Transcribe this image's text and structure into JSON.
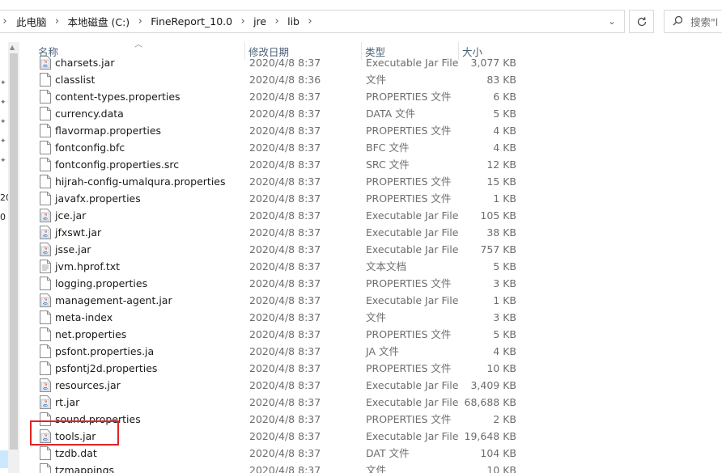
{
  "address_bar": {
    "lead_chevron": "›",
    "separator": "›",
    "breadcrumbs": [
      "此电脑",
      "本地磁盘 (C:)",
      "FineReport_10.0",
      "jre",
      "lib"
    ],
    "dropdown_icon": "chevron-down-icon"
  },
  "refresh": {
    "icon": "refresh-icon"
  },
  "search": {
    "placeholder": "搜索\"l"
  },
  "left_strip": {
    "labels": [
      "20",
      "0"
    ]
  },
  "columns": {
    "name": "名称",
    "date": "修改日期",
    "type": "类型",
    "size": "大小"
  },
  "files": [
    {
      "name": "charsets.jar",
      "date": "2020/4/8 8:37",
      "type": "Executable Jar File",
      "size": "3,077 KB",
      "icon": "jar-file-icon"
    },
    {
      "name": "classlist",
      "date": "2020/4/8 8:36",
      "type": "文件",
      "size": "83 KB",
      "icon": "file-icon"
    },
    {
      "name": "content-types.properties",
      "date": "2020/4/8 8:37",
      "type": "PROPERTIES 文件",
      "size": "6 KB",
      "icon": "file-icon"
    },
    {
      "name": "currency.data",
      "date": "2020/4/8 8:37",
      "type": "DATA 文件",
      "size": "5 KB",
      "icon": "file-icon"
    },
    {
      "name": "flavormap.properties",
      "date": "2020/4/8 8:37",
      "type": "PROPERTIES 文件",
      "size": "4 KB",
      "icon": "file-icon"
    },
    {
      "name": "fontconfig.bfc",
      "date": "2020/4/8 8:37",
      "type": "BFC 文件",
      "size": "4 KB",
      "icon": "file-icon"
    },
    {
      "name": "fontconfig.properties.src",
      "date": "2020/4/8 8:37",
      "type": "SRC 文件",
      "size": "12 KB",
      "icon": "file-icon"
    },
    {
      "name": "hijrah-config-umalqura.properties",
      "date": "2020/4/8 8:37",
      "type": "PROPERTIES 文件",
      "size": "15 KB",
      "icon": "file-icon"
    },
    {
      "name": "javafx.properties",
      "date": "2020/4/8 8:37",
      "type": "PROPERTIES 文件",
      "size": "1 KB",
      "icon": "file-icon"
    },
    {
      "name": "jce.jar",
      "date": "2020/4/8 8:37",
      "type": "Executable Jar File",
      "size": "105 KB",
      "icon": "jar-file-icon"
    },
    {
      "name": "jfxswt.jar",
      "date": "2020/4/8 8:37",
      "type": "Executable Jar File",
      "size": "38 KB",
      "icon": "jar-file-icon"
    },
    {
      "name": "jsse.jar",
      "date": "2020/4/8 8:37",
      "type": "Executable Jar File",
      "size": "757 KB",
      "icon": "jar-file-icon"
    },
    {
      "name": "jvm.hprof.txt",
      "date": "2020/4/8 8:37",
      "type": "文本文档",
      "size": "5 KB",
      "icon": "text-file-icon"
    },
    {
      "name": "logging.properties",
      "date": "2020/4/8 8:37",
      "type": "PROPERTIES 文件",
      "size": "3 KB",
      "icon": "file-icon"
    },
    {
      "name": "management-agent.jar",
      "date": "2020/4/8 8:37",
      "type": "Executable Jar File",
      "size": "1 KB",
      "icon": "jar-file-icon"
    },
    {
      "name": "meta-index",
      "date": "2020/4/8 8:37",
      "type": "文件",
      "size": "3 KB",
      "icon": "file-icon"
    },
    {
      "name": "net.properties",
      "date": "2020/4/8 8:37",
      "type": "PROPERTIES 文件",
      "size": "5 KB",
      "icon": "file-icon"
    },
    {
      "name": "psfont.properties.ja",
      "date": "2020/4/8 8:37",
      "type": "JA 文件",
      "size": "4 KB",
      "icon": "file-icon"
    },
    {
      "name": "psfontj2d.properties",
      "date": "2020/4/8 8:37",
      "type": "PROPERTIES 文件",
      "size": "10 KB",
      "icon": "file-icon"
    },
    {
      "name": "resources.jar",
      "date": "2020/4/8 8:37",
      "type": "Executable Jar File",
      "size": "3,409 KB",
      "icon": "jar-file-icon"
    },
    {
      "name": "rt.jar",
      "date": "2020/4/8 8:37",
      "type": "Executable Jar File",
      "size": "68,688 KB",
      "icon": "jar-file-icon"
    },
    {
      "name": "sound.properties",
      "date": "2020/4/8 8:37",
      "type": "PROPERTIES 文件",
      "size": "2 KB",
      "icon": "file-icon"
    },
    {
      "name": "tools.jar",
      "date": "2020/4/8 8:37",
      "type": "Executable Jar File",
      "size": "19,648 KB",
      "icon": "jar-file-icon",
      "highlighted": true
    },
    {
      "name": "tzdb.dat",
      "date": "2020/4/8 8:37",
      "type": "DAT 文件",
      "size": "104 KB",
      "icon": "file-icon"
    },
    {
      "name": "tzmappings",
      "date": "2020/4/8 8:37",
      "type": "文件",
      "size": "10 KB",
      "icon": "file-icon"
    }
  ],
  "colors": {
    "highlight_border": "#e32222",
    "header_text": "#4c607a",
    "meta_text": "#6d6d6d"
  }
}
